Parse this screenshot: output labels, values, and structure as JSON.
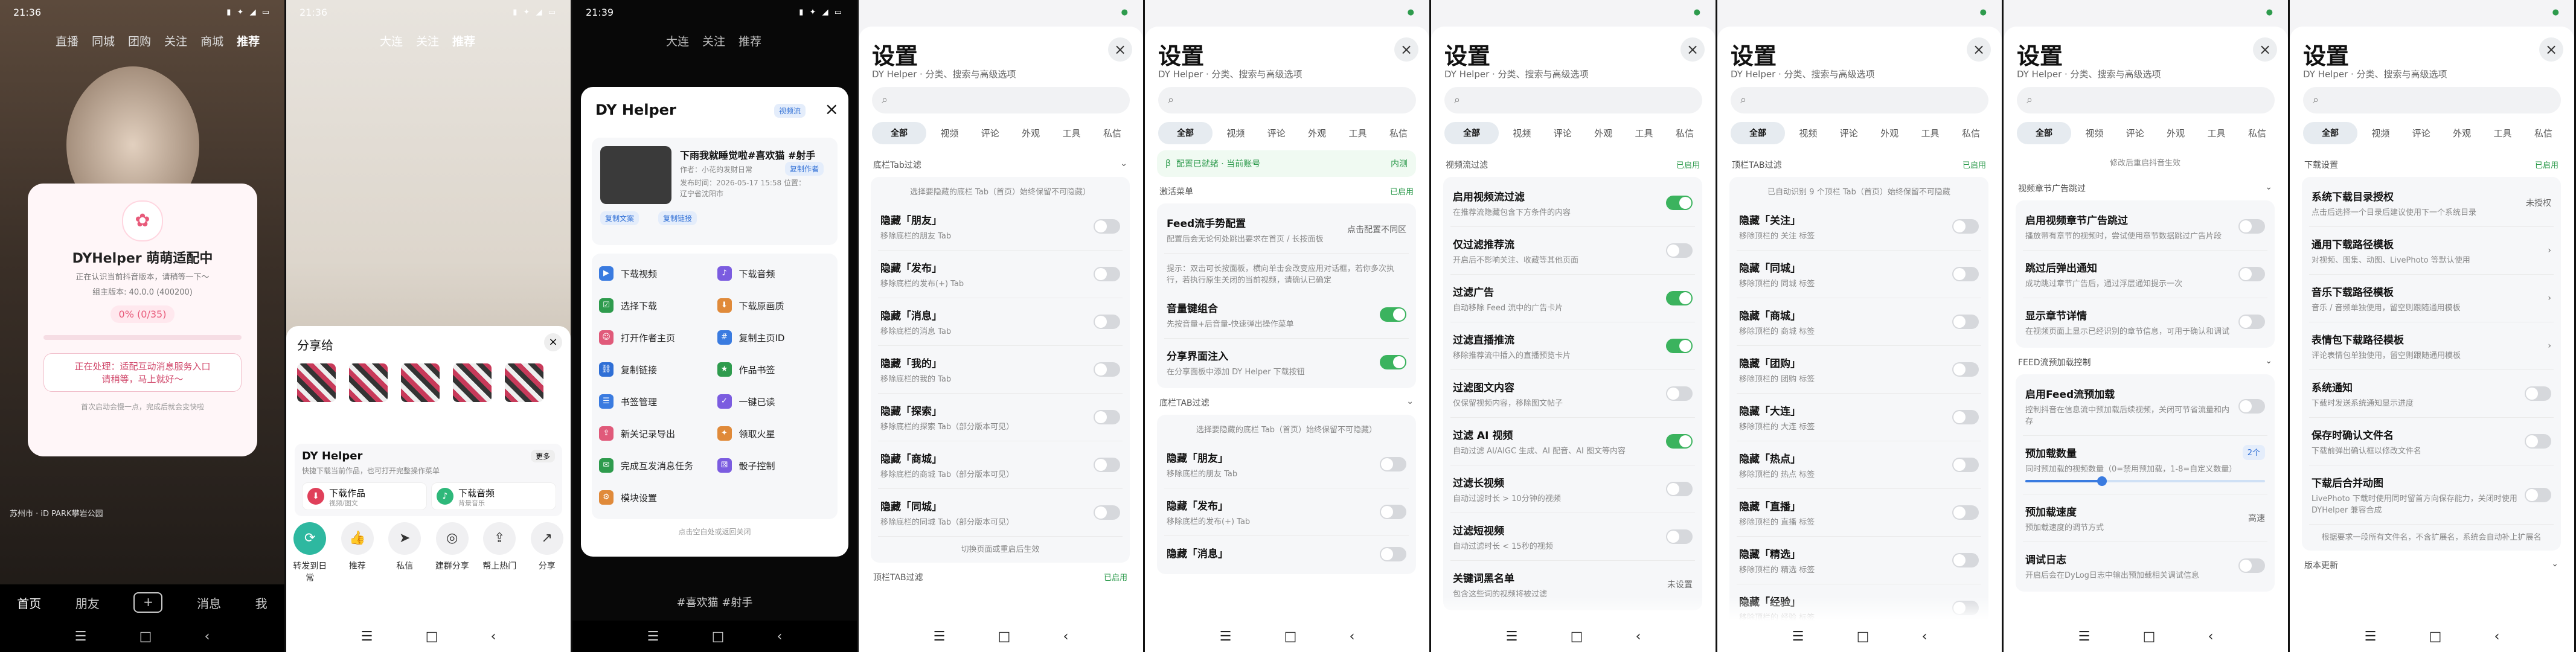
{
  "phones": [
    {
      "time": "21:36",
      "status_icons": "▮ ✦ ◢ ▭"
    },
    {
      "time": "21:36",
      "status_icons": "▮ ✦ ◢ ▭"
    },
    {
      "time": "21:39",
      "status_icons": "▮ ✦ ◢ ▭"
    }
  ],
  "nav": {
    "menu": "☰",
    "home": "□",
    "back": "‹"
  },
  "p1": {
    "top_tabs": [
      "直播",
      "同城",
      "团购",
      "关注",
      "商城",
      "推荐"
    ],
    "active_tab": "推荐",
    "dialog_title": "DYHelper 萌萌适配中",
    "dialog_line1": "正在认识当前抖音版本，请稍等一下～",
    "dialog_line2": "组主版本: 40.0.0 (400200)",
    "progress_text": "0% (0/35)",
    "progress": 0,
    "box_line1": "正在处理：适配互动消息服务入口",
    "box_line2": "请稍等，马上就好～",
    "small_note": "首次启动会慢一点，完成后就会变快啦",
    "location": "苏州市 · iD PARK攀岩公园",
    "bottom_nav": [
      "首页",
      "朋友",
      "+",
      "消息",
      "我"
    ]
  },
  "p2": {
    "top_tabs": [
      "大连",
      "关注",
      "推荐"
    ],
    "share_title": "分享给",
    "dy_title": "DY Helper",
    "dy_desc": "快捷下载当前作品，也可打开完整操作菜单",
    "more": "更多",
    "dl_video": "下载作品",
    "dl_video_sub": "视频/图文",
    "dl_audio": "下载音频",
    "dl_audio_sub": "背景音乐",
    "actions": [
      "转发到日常",
      "推荐",
      "私信",
      "建群分享",
      "帮上热门",
      "分享"
    ]
  },
  "p3": {
    "top_tabs": [
      "大连",
      "关注",
      "推荐"
    ],
    "title": "DY Helper",
    "badge": "视频流",
    "video_title": "下雨我就睡觉啦#喜欢猫 #射手",
    "author": "作者：小花的发财日常",
    "copy_author": "复制作者",
    "publish": "发布时间：2026-05-17 15:58 位置：",
    "ip": "辽宁省沈阳市",
    "copy_text": "复制文案",
    "copy_link": "复制链接",
    "grid": [
      [
        "下载视频",
        "#3a7be0",
        "▶"
      ],
      [
        "下载音频",
        "#7b5ce0",
        "♪"
      ],
      [
        "选择下载",
        "#2e9b4d",
        "☑"
      ],
      [
        "下载原画质",
        "#e08a3a",
        "⬇"
      ],
      [
        "打开作者主页",
        "#e05a7a",
        "☺"
      ],
      [
        "复制主页ID",
        "#3a7be0",
        "#"
      ],
      [
        "复制链接",
        "#2f6fd6",
        "⛓"
      ],
      [
        "作品书签",
        "#2e9b4d",
        "★"
      ],
      [
        "书签管理",
        "#3a7be0",
        "☰"
      ],
      [
        "一键已读",
        "#7b5ce0",
        "✓"
      ],
      [
        "新关记录导出",
        "#e05a7a",
        "⇪"
      ],
      [
        "领取火星",
        "#e08a3a",
        "✦"
      ],
      [
        "完成互发消息任务",
        "#2e9b4d",
        "✉"
      ],
      [
        "骰子控制",
        "#7b5ce0",
        "⚄"
      ],
      [
        "模块设置",
        "#e08a3a",
        "⚙"
      ]
    ],
    "footer": "点击空白处或返回关闭",
    "hashtag": "#喜欢猫 #射手"
  },
  "settings": {
    "title": "设置",
    "subtitle": "DY Helper · 分类、搜索与高级选项",
    "close": "×",
    "search_icon": "⌕",
    "tabs": [
      "全部",
      "视频",
      "评论",
      "外观",
      "工具",
      "私信"
    ],
    "s1": {
      "section": "底栏Tab过滤",
      "hint": "选择要隐藏的底栏 Tab（首页）始终保留不可隐藏）",
      "rows": [
        {
          "t": "隐藏「朋友」",
          "d": "移除底栏的朋友 Tab"
        },
        {
          "t": "隐藏「发布」",
          "d": "移除底栏的发布(+) Tab"
        },
        {
          "t": "隐藏「消息」",
          "d": "移除底栏的消息 Tab"
        },
        {
          "t": "隐藏「我的」",
          "d": "移除底栏的我的 Tab"
        },
        {
          "t": "隐藏「探索」",
          "d": "移除底栏的探索 Tab（部分版本可见）"
        },
        {
          "t": "隐藏「商城」",
          "d": "移除底栏的商城 Tab（部分版本可见）"
        },
        {
          "t": "隐藏「同城」",
          "d": "移除底栏的同城 Tab（部分版本可见）"
        }
      ],
      "foot_hint": "切换页面或重启后生效",
      "next_section": "顶栏TAB过滤",
      "next_status": "已启用"
    },
    "s2": {
      "beta": "配置已就绪 · 当前账号",
      "beta_right": "内测",
      "section": "激活菜单",
      "section_status": "已启用",
      "feed_title": "Feed流手势配置",
      "feed_desc": "配置后会无论何处跳出要求在首页 / 长按面板",
      "feed_value": "点击配置不同区",
      "notice": "提示：双击可长按面板，横向单击会改变应用对话框，若你多次执行，若执行原生关闭的当前视频，请确认已确定",
      "rows": [
        {
          "t": "音量键组合",
          "d": "先按音量+后音量-快速弹出操作菜单",
          "on": true
        },
        {
          "t": "分享界面注入",
          "d": "在分享面板中添加 DY Helper 下载按钮",
          "on": true
        }
      ],
      "sec2": "底栏TAB过滤",
      "hint": "选择要隐藏的底栏 Tab（首页）始终保留不可隐藏）",
      "rows2": [
        {
          "t": "隐藏「朋友」",
          "d": "移除底栏的朋友 Tab"
        },
        {
          "t": "隐藏「发布」",
          "d": "移除底栏的发布(+) Tab"
        },
        {
          "t": "隐藏「消息」",
          "d": ""
        }
      ]
    },
    "s3": {
      "section": "视频流过滤",
      "section_status": "已启用",
      "rows": [
        {
          "t": "启用视频流过滤",
          "d": "在推荐流隐藏包含下方条件的内容",
          "on": true
        },
        {
          "t": "仅过滤推荐流",
          "d": "开启后不影响关注、收藏等其他页面",
          "on": false
        },
        {
          "t": "过滤广告",
          "d": "自动移除 Feed 流中的广告卡片",
          "on": true
        },
        {
          "t": "过滤直播推流",
          "d": "移除推荐流中插入的直播预览卡片",
          "on": true
        },
        {
          "t": "过滤图文内容",
          "d": "仅保留视频内容，移除图文帖子",
          "on": false
        },
        {
          "t": "过滤 AI 视频",
          "d": "自动过滤 AI/AIGC 生成、AI 配音、AI 图文等内容",
          "on": true
        },
        {
          "t": "过滤长视频",
          "d": "自动过滤时长 > 10分钟的视频",
          "on": false
        },
        {
          "t": "过滤短视频",
          "d": "自动过滤时长 < 15秒的视频",
          "on": false
        }
      ],
      "kw_title": "关键词黑名单",
      "kw_desc": "包含这些词的视频将被过滤",
      "kw_value": "未设置"
    },
    "s4": {
      "section": "顶栏TAB过滤",
      "section_status": "已启用",
      "hint": "已自动识别 9 个顶栏 Tab（首页）始终保留不可隐藏",
      "rows": [
        {
          "t": "隐藏「关注」",
          "d": "移除顶栏的 关注 标签"
        },
        {
          "t": "隐藏「同城」",
          "d": "移除顶栏的 同城 标签"
        },
        {
          "t": "隐藏「商城」",
          "d": "移除顶栏的 商城 标签"
        },
        {
          "t": "隐藏「团购」",
          "d": "移除顶栏的 团购 标签"
        },
        {
          "t": "隐藏「大连」",
          "d": "移除顶栏的 大连 标签"
        },
        {
          "t": "隐藏「热点」",
          "d": "移除顶栏的 热点 标签"
        },
        {
          "t": "隐藏「直播」",
          "d": "移除顶栏的 直播 标签"
        },
        {
          "t": "隐藏「精选」",
          "d": "移除顶栏的 精选 标签"
        },
        {
          "t": "隐藏「经验」",
          "d": "移除顶栏的 经验 标签"
        }
      ]
    },
    "s5": {
      "top_hint": "修改后重启抖音生效",
      "section": "视频章节广告跳过",
      "rows": [
        {
          "t": "启用视频章节广告跳过",
          "d": "播放带有章节的视频时，尝试使用章节数据跳过广告片段",
          "on": false
        },
        {
          "t": "跳过后弹出通知",
          "d": "成功跳过章节广告后，通过浮层通知提示一次",
          "on": false
        },
        {
          "t": "显示章节详情",
          "d": "在视频页面上显示已经识别的章节信息，可用于确认和调试",
          "on": false
        }
      ],
      "sec2": "FEED流预加载控制",
      "feed_rows": [
        {
          "t": "启用Feed流预加载",
          "d": "控制抖音在信息流中预加载后续视频，关闭可节省流量和内存",
          "on": false
        }
      ],
      "pre_title": "预加载数量",
      "pre_desc": "同时预加载的视频数量（0=禁用预加载，1-8=自定义数量）",
      "pre_value": "2个",
      "pre_level": 0.32,
      "speed_title": "预加载速度",
      "speed_desc": "预加载速度的调节方式",
      "speed_value": "高速",
      "log_title": "调试日志",
      "log_desc": "开启后会在DyLog日志中输出预加载相关调试信息"
    },
    "s6": {
      "section": "下载设置",
      "section_status": "已启用",
      "rows": [
        {
          "t": "系统下载目录授权",
          "d": "点击后选择一个目录后建议使用下一个系统目录",
          "v": "未授权"
        },
        {
          "t": "通用下载路径模板",
          "d": "对视频、图集、动图、LivePhoto 等默认使用",
          "v": "›"
        },
        {
          "t": "音乐下载路径模板",
          "d": "音乐 / 音频单独使用，留空则跟随通用模板",
          "v": "›"
        },
        {
          "t": "表情包下载路径模板",
          "d": "评论表情包单独使用，留空则跟随通用模板",
          "v": "›"
        }
      ],
      "toggles": [
        {
          "t": "系统通知",
          "d": "下载时发送系统通知显示进度",
          "on": false
        },
        {
          "t": "保存时确认文件名",
          "d": "下载前弹出确认框以修改文件名",
          "on": false
        },
        {
          "t": "下载后合并动图",
          "d": "LivePhoto 下载时使用同时留首方向保存能力，关闭时使用 DYHelper 兼容合成",
          "on": false
        }
      ],
      "footer": "根据要求一段所有文件名，不含扩展名，系统会自动补上扩展名",
      "sec2": "版本更新"
    }
  }
}
